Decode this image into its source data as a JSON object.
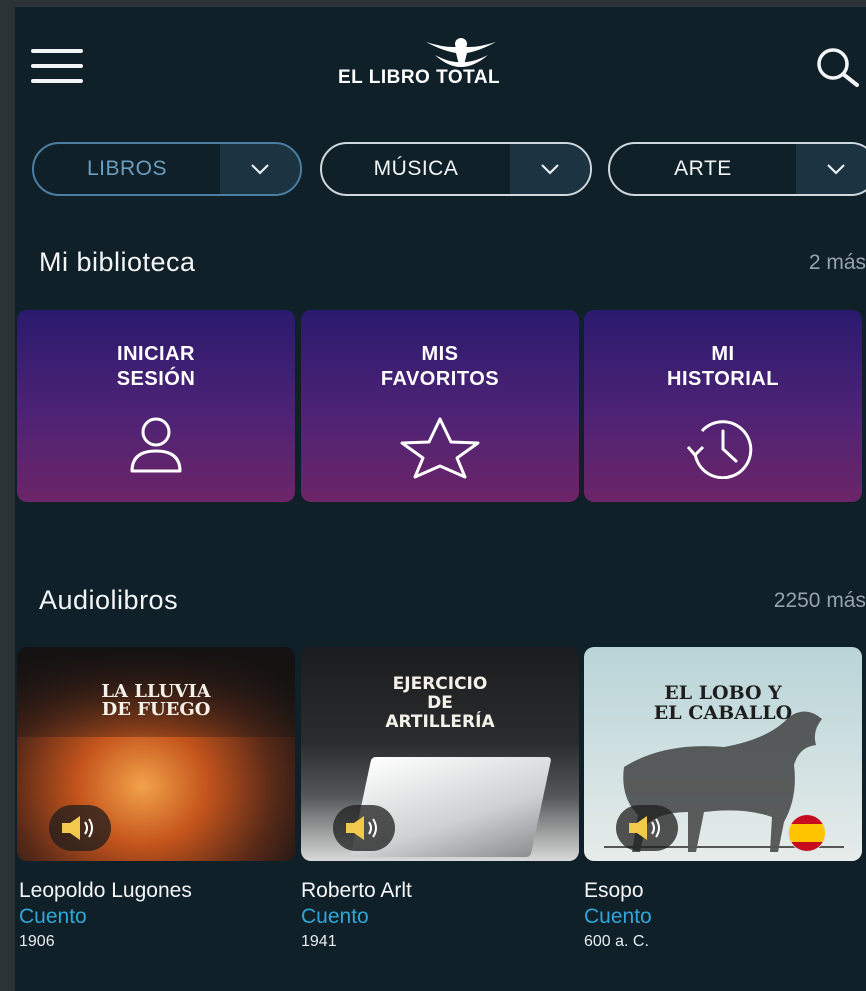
{
  "header": {
    "logo_text": "EL LIBRO TOTAL",
    "menu_icon": "hamburger-menu-icon",
    "search_icon": "search-icon"
  },
  "categories": [
    {
      "label": "LIBROS",
      "active": true
    },
    {
      "label": "MÚSICA",
      "active": false
    },
    {
      "label": "ARTE",
      "active": false
    }
  ],
  "library": {
    "title": "Mi biblioteca",
    "more": "2 más",
    "cards": [
      {
        "label": "INICIAR\nSESIÓN",
        "icon": "user-icon"
      },
      {
        "label": "MIS\nFAVORITOS",
        "icon": "star-icon"
      },
      {
        "label": "MI\nHISTORIAL",
        "icon": "history-icon"
      }
    ]
  },
  "audiobooks": {
    "title": "Audiolibros",
    "more": "2250 más",
    "items": [
      {
        "cover_title_1": "LA LLUVIA",
        "cover_title_2": "DE FUEGO",
        "author": "Leopoldo Lugones",
        "genre": "Cuento",
        "year": "1906"
      },
      {
        "cover_title_1": "EJERCICIO",
        "cover_title_2": "DE",
        "cover_title_3": "ARTILLERÍA",
        "author": "Roberto Arlt",
        "genre": "Cuento",
        "year": "1941"
      },
      {
        "cover_title_1": "EL LOBO Y",
        "cover_title_2": "EL CABALLO",
        "author": "Esopo",
        "genre": "Cuento",
        "year": "600 a. C."
      }
    ]
  },
  "colors": {
    "background": "#0f2028",
    "accent_blue": "#2fa6d9",
    "card_top": "#2a1a6e",
    "card_bottom": "#6c2567"
  }
}
